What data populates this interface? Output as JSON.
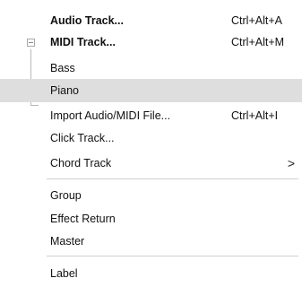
{
  "menu": {
    "audio_track": {
      "label": "Audio Track...",
      "shortcut": "Ctrl+Alt+A"
    },
    "midi_track": {
      "label": "MIDI Track...",
      "shortcut": "Ctrl+Alt+M"
    },
    "bass": {
      "label": "Bass"
    },
    "piano": {
      "label": "Piano"
    },
    "import_file": {
      "label": "Import Audio/MIDI File...",
      "shortcut": "Ctrl+Alt+I"
    },
    "click_track": {
      "label": "Click Track..."
    },
    "chord_track": {
      "label": "Chord Track",
      "submenu_arrow": ">"
    },
    "group": {
      "label": "Group"
    },
    "effect_return": {
      "label": "Effect Return"
    },
    "master": {
      "label": "Master"
    },
    "label_item": {
      "label": "Label"
    }
  },
  "icons": {
    "collapse": "collapse-minus-icon",
    "submenu": "chevron-right-icon"
  },
  "colors": {
    "highlight": "#dedede",
    "separator": "#cfcfcf",
    "text": "#111111"
  }
}
